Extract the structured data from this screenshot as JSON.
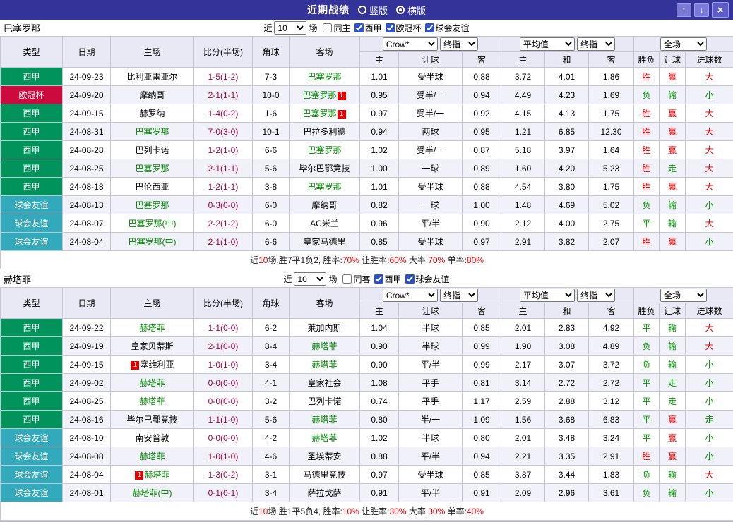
{
  "topbar": {
    "title": "近期战绩",
    "radios": [
      {
        "label": "竖版",
        "selected": false
      },
      {
        "label": "横版",
        "selected": true
      }
    ],
    "up_icon": "↑",
    "down_icon": "↓",
    "close_icon": "×"
  },
  "table_header": {
    "columns": [
      "类型",
      "日期",
      "主场",
      "比分(半场)",
      "角球",
      "客场"
    ],
    "odds_group": {
      "company": "Crow*",
      "period": "终指",
      "sub": [
        "主",
        "让球",
        "客"
      ]
    },
    "avg_group": {
      "company": "平均值",
      "period": "终指",
      "sub": [
        "主",
        "和",
        "客"
      ]
    },
    "result_group": {
      "scope": "全场",
      "sub": [
        "胜负",
        "让球",
        "进球数"
      ]
    }
  },
  "sections": [
    {
      "team": "巴塞罗那",
      "filter": {
        "near_label": "近",
        "count": "10",
        "games_label": "场",
        "checkboxes": [
          {
            "label": "同主",
            "checked": false
          },
          {
            "label": "西甲",
            "checked": true
          },
          {
            "label": "欧冠杯",
            "checked": true
          },
          {
            "label": "球会友谊",
            "checked": true
          }
        ]
      },
      "rows": [
        {
          "type": "西甲",
          "type_key": "liga",
          "date": "24-09-23",
          "home": {
            "name": "比利亚雷亚尔",
            "focal": false
          },
          "score": "1-5(1-2)",
          "corner": "7-3",
          "away": {
            "name": "巴塞罗那",
            "focal": true
          },
          "odds1": [
            "1.01",
            "受半球",
            "0.88"
          ],
          "odds2": [
            "3.72",
            "4.01",
            "1.86"
          ],
          "result": [
            {
              "text": "胜",
              "color": "r"
            },
            {
              "text": "赢",
              "color": "r"
            },
            {
              "text": "大",
              "color": "r"
            }
          ]
        },
        {
          "type": "欧冠杯",
          "type_key": "ucl",
          "date": "24-09-20",
          "home": {
            "name": "摩纳哥",
            "focal": false
          },
          "score": "2-1(1-1)",
          "corner": "10-0",
          "away": {
            "name": "巴塞罗那",
            "focal": true,
            "badge": "1",
            "badge_pos": "after"
          },
          "odds1": [
            "0.95",
            "受半/一",
            "0.94"
          ],
          "odds2": [
            "4.49",
            "4.23",
            "1.69"
          ],
          "result": [
            {
              "text": "负",
              "color": "g"
            },
            {
              "text": "输",
              "color": "g"
            },
            {
              "text": "小",
              "color": "g"
            }
          ]
        },
        {
          "type": "西甲",
          "type_key": "liga",
          "date": "24-09-15",
          "home": {
            "name": "赫罗纳",
            "focal": false
          },
          "score": "1-4(0-2)",
          "corner": "1-6",
          "away": {
            "name": "巴塞罗那",
            "focal": true,
            "badge": "1",
            "badge_pos": "after"
          },
          "odds1": [
            "0.97",
            "受半/一",
            "0.92"
          ],
          "odds2": [
            "4.15",
            "4.13",
            "1.75"
          ],
          "result": [
            {
              "text": "胜",
              "color": "r"
            },
            {
              "text": "赢",
              "color": "r"
            },
            {
              "text": "大",
              "color": "r"
            }
          ]
        },
        {
          "type": "西甲",
          "type_key": "liga",
          "date": "24-08-31",
          "home": {
            "name": "巴塞罗那",
            "focal": true
          },
          "score": "7-0(3-0)",
          "corner": "10-1",
          "away": {
            "name": "巴拉多利德",
            "focal": false
          },
          "odds1": [
            "0.94",
            "两球",
            "0.95"
          ],
          "odds2": [
            "1.21",
            "6.85",
            "12.30"
          ],
          "result": [
            {
              "text": "胜",
              "color": "r"
            },
            {
              "text": "赢",
              "color": "r"
            },
            {
              "text": "大",
              "color": "r"
            }
          ]
        },
        {
          "type": "西甲",
          "type_key": "liga",
          "date": "24-08-28",
          "home": {
            "name": "巴列卡诺",
            "focal": false
          },
          "score": "1-2(1-0)",
          "corner": "6-6",
          "away": {
            "name": "巴塞罗那",
            "focal": true
          },
          "odds1": [
            "1.02",
            "受半/一",
            "0.87"
          ],
          "odds2": [
            "5.18",
            "3.97",
            "1.64"
          ],
          "result": [
            {
              "text": "胜",
              "color": "r"
            },
            {
              "text": "赢",
              "color": "r"
            },
            {
              "text": "大",
              "color": "r"
            }
          ]
        },
        {
          "type": "西甲",
          "type_key": "liga",
          "date": "24-08-25",
          "home": {
            "name": "巴塞罗那",
            "focal": true
          },
          "score": "2-1(1-1)",
          "corner": "5-6",
          "away": {
            "name": "毕尔巴鄂竞技",
            "focal": false
          },
          "odds1": [
            "1.00",
            "一球",
            "0.89"
          ],
          "odds2": [
            "1.60",
            "4.20",
            "5.23"
          ],
          "result": [
            {
              "text": "胜",
              "color": "r"
            },
            {
              "text": "走",
              "color": "g"
            },
            {
              "text": "大",
              "color": "r"
            }
          ]
        },
        {
          "type": "西甲",
          "type_key": "liga",
          "date": "24-08-18",
          "home": {
            "name": "巴伦西亚",
            "focal": false
          },
          "score": "1-2(1-1)",
          "corner": "3-8",
          "away": {
            "name": "巴塞罗那",
            "focal": true
          },
          "odds1": [
            "1.01",
            "受半球",
            "0.88"
          ],
          "odds2": [
            "4.54",
            "3.80",
            "1.75"
          ],
          "result": [
            {
              "text": "胜",
              "color": "r"
            },
            {
              "text": "赢",
              "color": "r"
            },
            {
              "text": "大",
              "color": "r"
            }
          ]
        },
        {
          "type": "球会友谊",
          "type_key": "friendly",
          "date": "24-08-13",
          "home": {
            "name": "巴塞罗那",
            "focal": true
          },
          "score": "0-3(0-0)",
          "corner": "6-0",
          "away": {
            "name": "摩纳哥",
            "focal": false
          },
          "odds1": [
            "0.82",
            "一球",
            "1.00"
          ],
          "odds2": [
            "1.48",
            "4.69",
            "5.02"
          ],
          "result": [
            {
              "text": "负",
              "color": "g"
            },
            {
              "text": "输",
              "color": "g"
            },
            {
              "text": "小",
              "color": "g"
            }
          ]
        },
        {
          "type": "球会友谊",
          "type_key": "friendly",
          "date": "24-08-07",
          "home": {
            "name": "巴塞罗那(中)",
            "focal": true
          },
          "score": "2-2(1-2)",
          "corner": "6-0",
          "away": {
            "name": "AC米兰",
            "focal": false
          },
          "odds1": [
            "0.96",
            "平/半",
            "0.90"
          ],
          "odds2": [
            "2.12",
            "4.00",
            "2.75"
          ],
          "result": [
            {
              "text": "平",
              "color": "g"
            },
            {
              "text": "输",
              "color": "g"
            },
            {
              "text": "大",
              "color": "r"
            }
          ]
        },
        {
          "type": "球会友谊",
          "type_key": "friendly",
          "date": "24-08-04",
          "home": {
            "name": "巴塞罗那(中)",
            "focal": true
          },
          "score": "2-1(1-0)",
          "corner": "6-6",
          "away": {
            "name": "皇家马德里",
            "focal": false
          },
          "odds1": [
            "0.85",
            "受半球",
            "0.97"
          ],
          "odds2": [
            "2.91",
            "3.82",
            "2.07"
          ],
          "result": [
            {
              "text": "胜",
              "color": "r"
            },
            {
              "text": "赢",
              "color": "r"
            },
            {
              "text": "小",
              "color": "g"
            }
          ]
        }
      ],
      "summary": [
        {
          "text": "近",
          "color": "k"
        },
        {
          "text": "10",
          "color": "r"
        },
        {
          "text": "场,胜7平1负2, 胜率:",
          "color": "k"
        },
        {
          "text": "70%",
          "color": "r"
        },
        {
          "text": " 让胜率:",
          "color": "k"
        },
        {
          "text": "60%",
          "color": "r"
        },
        {
          "text": " 大率:",
          "color": "k"
        },
        {
          "text": "70%",
          "color": "r"
        },
        {
          "text": " 单率:",
          "color": "k"
        },
        {
          "text": "80%",
          "color": "r"
        }
      ]
    },
    {
      "team": "赫塔菲",
      "filter": {
        "near_label": "近",
        "count": "10",
        "games_label": "场",
        "checkboxes": [
          {
            "label": "同客",
            "checked": false
          },
          {
            "label": "西甲",
            "checked": true
          },
          {
            "label": "球会友谊",
            "checked": true
          }
        ]
      },
      "rows": [
        {
          "type": "西甲",
          "type_key": "liga",
          "date": "24-09-22",
          "home": {
            "name": "赫塔菲",
            "focal": true
          },
          "score": "1-1(0-0)",
          "corner": "6-2",
          "away": {
            "name": "莱加内斯",
            "focal": false
          },
          "odds1": [
            "1.04",
            "半球",
            "0.85"
          ],
          "odds2": [
            "2.01",
            "2.83",
            "4.92"
          ],
          "result": [
            {
              "text": "平",
              "color": "g"
            },
            {
              "text": "输",
              "color": "g"
            },
            {
              "text": "大",
              "color": "r"
            }
          ]
        },
        {
          "type": "西甲",
          "type_key": "liga",
          "date": "24-09-19",
          "home": {
            "name": "皇家贝蒂斯",
            "focal": false
          },
          "score": "2-1(0-0)",
          "corner": "8-4",
          "away": {
            "name": "赫塔菲",
            "focal": true
          },
          "odds1": [
            "0.90",
            "半球",
            "0.99"
          ],
          "odds2": [
            "1.90",
            "3.08",
            "4.89"
          ],
          "result": [
            {
              "text": "负",
              "color": "g"
            },
            {
              "text": "输",
              "color": "g"
            },
            {
              "text": "大",
              "color": "r"
            }
          ]
        },
        {
          "type": "西甲",
          "type_key": "liga",
          "date": "24-09-15",
          "home": {
            "name": "塞维利亚",
            "focal": false,
            "badge": "1",
            "badge_pos": "before"
          },
          "score": "1-0(1-0)",
          "corner": "3-4",
          "away": {
            "name": "赫塔菲",
            "focal": true
          },
          "odds1": [
            "0.90",
            "平/半",
            "0.99"
          ],
          "odds2": [
            "2.17",
            "3.07",
            "3.72"
          ],
          "result": [
            {
              "text": "负",
              "color": "g"
            },
            {
              "text": "输",
              "color": "g"
            },
            {
              "text": "小",
              "color": "g"
            }
          ]
        },
        {
          "type": "西甲",
          "type_key": "liga",
          "date": "24-09-02",
          "home": {
            "name": "赫塔菲",
            "focal": true
          },
          "score": "0-0(0-0)",
          "corner": "4-1",
          "away": {
            "name": "皇家社会",
            "focal": false
          },
          "odds1": [
            "1.08",
            "平手",
            "0.81"
          ],
          "odds2": [
            "3.14",
            "2.72",
            "2.72"
          ],
          "result": [
            {
              "text": "平",
              "color": "g"
            },
            {
              "text": "走",
              "color": "g"
            },
            {
              "text": "小",
              "color": "g"
            }
          ]
        },
        {
          "type": "西甲",
          "type_key": "liga",
          "date": "24-08-25",
          "home": {
            "name": "赫塔菲",
            "focal": true
          },
          "score": "0-0(0-0)",
          "corner": "3-2",
          "away": {
            "name": "巴列卡诺",
            "focal": false
          },
          "odds1": [
            "0.74",
            "平手",
            "1.17"
          ],
          "odds2": [
            "2.59",
            "2.88",
            "3.12"
          ],
          "result": [
            {
              "text": "平",
              "color": "g"
            },
            {
              "text": "走",
              "color": "g"
            },
            {
              "text": "小",
              "color": "g"
            }
          ]
        },
        {
          "type": "西甲",
          "type_key": "liga",
          "date": "24-08-16",
          "home": {
            "name": "毕尔巴鄂竞技",
            "focal": false
          },
          "score": "1-1(1-0)",
          "corner": "5-6",
          "away": {
            "name": "赫塔菲",
            "focal": true
          },
          "odds1": [
            "0.80",
            "半/一",
            "1.09"
          ],
          "odds2": [
            "1.56",
            "3.68",
            "6.83"
          ],
          "result": [
            {
              "text": "平",
              "color": "g"
            },
            {
              "text": "赢",
              "color": "r"
            },
            {
              "text": "走",
              "color": "g"
            }
          ]
        },
        {
          "type": "球会友谊",
          "type_key": "friendly",
          "date": "24-08-10",
          "home": {
            "name": "南安普敦",
            "focal": false
          },
          "score": "0-0(0-0)",
          "corner": "4-2",
          "away": {
            "name": "赫塔菲",
            "focal": true
          },
          "odds1": [
            "1.02",
            "半球",
            "0.80"
          ],
          "odds2": [
            "2.01",
            "3.48",
            "3.24"
          ],
          "result": [
            {
              "text": "平",
              "color": "g"
            },
            {
              "text": "赢",
              "color": "r"
            },
            {
              "text": "小",
              "color": "g"
            }
          ]
        },
        {
          "type": "球会友谊",
          "type_key": "friendly",
          "date": "24-08-08",
          "home": {
            "name": "赫塔菲",
            "focal": true
          },
          "score": "1-0(1-0)",
          "corner": "4-6",
          "away": {
            "name": "圣埃蒂安",
            "focal": false
          },
          "odds1": [
            "0.88",
            "平/半",
            "0.94"
          ],
          "odds2": [
            "2.21",
            "3.35",
            "2.91"
          ],
          "result": [
            {
              "text": "胜",
              "color": "r"
            },
            {
              "text": "赢",
              "color": "r"
            },
            {
              "text": "小",
              "color": "g"
            }
          ]
        },
        {
          "type": "球会友谊",
          "type_key": "friendly",
          "date": "24-08-04",
          "home": {
            "name": "赫塔菲",
            "focal": true,
            "badge": "1",
            "badge_pos": "before"
          },
          "score": "1-3(0-2)",
          "corner": "3-1",
          "away": {
            "name": "马德里竞技",
            "focal": false
          },
          "odds1": [
            "0.97",
            "受半球",
            "0.85"
          ],
          "odds2": [
            "3.87",
            "3.44",
            "1.83"
          ],
          "result": [
            {
              "text": "负",
              "color": "g"
            },
            {
              "text": "输",
              "color": "g"
            },
            {
              "text": "大",
              "color": "r"
            }
          ]
        },
        {
          "type": "球会友谊",
          "type_key": "friendly",
          "date": "24-08-01",
          "home": {
            "name": "赫塔菲(中)",
            "focal": true
          },
          "score": "0-1(0-1)",
          "corner": "3-4",
          "away": {
            "name": "萨拉戈萨",
            "focal": false
          },
          "odds1": [
            "0.91",
            "平/半",
            "0.91"
          ],
          "odds2": [
            "2.09",
            "2.96",
            "3.61"
          ],
          "result": [
            {
              "text": "负",
              "color": "g"
            },
            {
              "text": "输",
              "color": "g"
            },
            {
              "text": "小",
              "color": "g"
            }
          ]
        }
      ],
      "summary": [
        {
          "text": "近",
          "color": "k"
        },
        {
          "text": "10",
          "color": "r"
        },
        {
          "text": "场,胜1平5负4, 胜率:",
          "color": "k"
        },
        {
          "text": "10%",
          "color": "r"
        },
        {
          "text": " 让胜率:",
          "color": "k"
        },
        {
          "text": "30%",
          "color": "r"
        },
        {
          "text": " 大率:",
          "color": "k"
        },
        {
          "text": "30%",
          "color": "r"
        },
        {
          "text": " 单率:",
          "color": "k"
        },
        {
          "text": "40%",
          "color": "r"
        }
      ]
    }
  ]
}
